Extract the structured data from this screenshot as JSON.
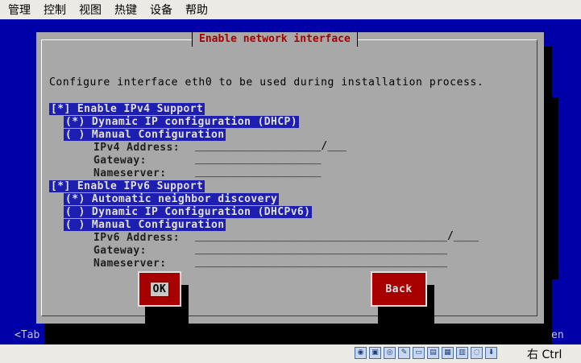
{
  "menubar": {
    "items": [
      "管理",
      "控制",
      "视图",
      "热键",
      "设备",
      "帮助"
    ]
  },
  "screen": {
    "hint_left": "<Tab",
    "hint_right": "en"
  },
  "dialog": {
    "title": "Enable network interface",
    "description": "Configure interface eth0 to be used during installation process.",
    "ipv4": {
      "checkbox": "[*] Enable IPv4 Support",
      "dhcp": "(*) Dynamic IP configuration (DHCP)",
      "manual": "( ) Manual Configuration",
      "address_label": "IPv4 Address:",
      "address_field": "____________________/___",
      "gateway_label": "Gateway:",
      "gateway_field": "____________________",
      "nameserver_label": "Nameserver:",
      "nameserver_field": "____________________"
    },
    "ipv6": {
      "checkbox": "[*] Enable IPv6 Support",
      "auto": "(*) Automatic neighbor discovery",
      "dhcp": "( ) Dynamic IP Configuration (DHCPv6)",
      "manual": "( ) Manual Configuration",
      "address_label": "IPv6 Address:",
      "address_field": "________________________________________/____",
      "gateway_label": "Gateway:",
      "gateway_field": "________________________________________",
      "nameserver_label": "Nameserver:",
      "nameserver_field": "________________________________________"
    },
    "buttons": {
      "ok": "OK",
      "back": "Back"
    }
  },
  "statusbar": {
    "icons": [
      "cdrom-icon",
      "floppy-icon",
      "optical-drive-icon",
      "pen-icon",
      "hard-disk-icon",
      "usb-icon",
      "network-icon",
      "shared-folder-icon",
      "capture-icon",
      "mouse-integration-icon"
    ],
    "hostkey": "右 Ctrl"
  },
  "colors": {
    "screen_bg": "#0000a8",
    "dialog_bg": "#a8a8a8",
    "title_text": "#a80000",
    "selection_bg": "#1e1eb0",
    "button_bg": "#a80000"
  }
}
